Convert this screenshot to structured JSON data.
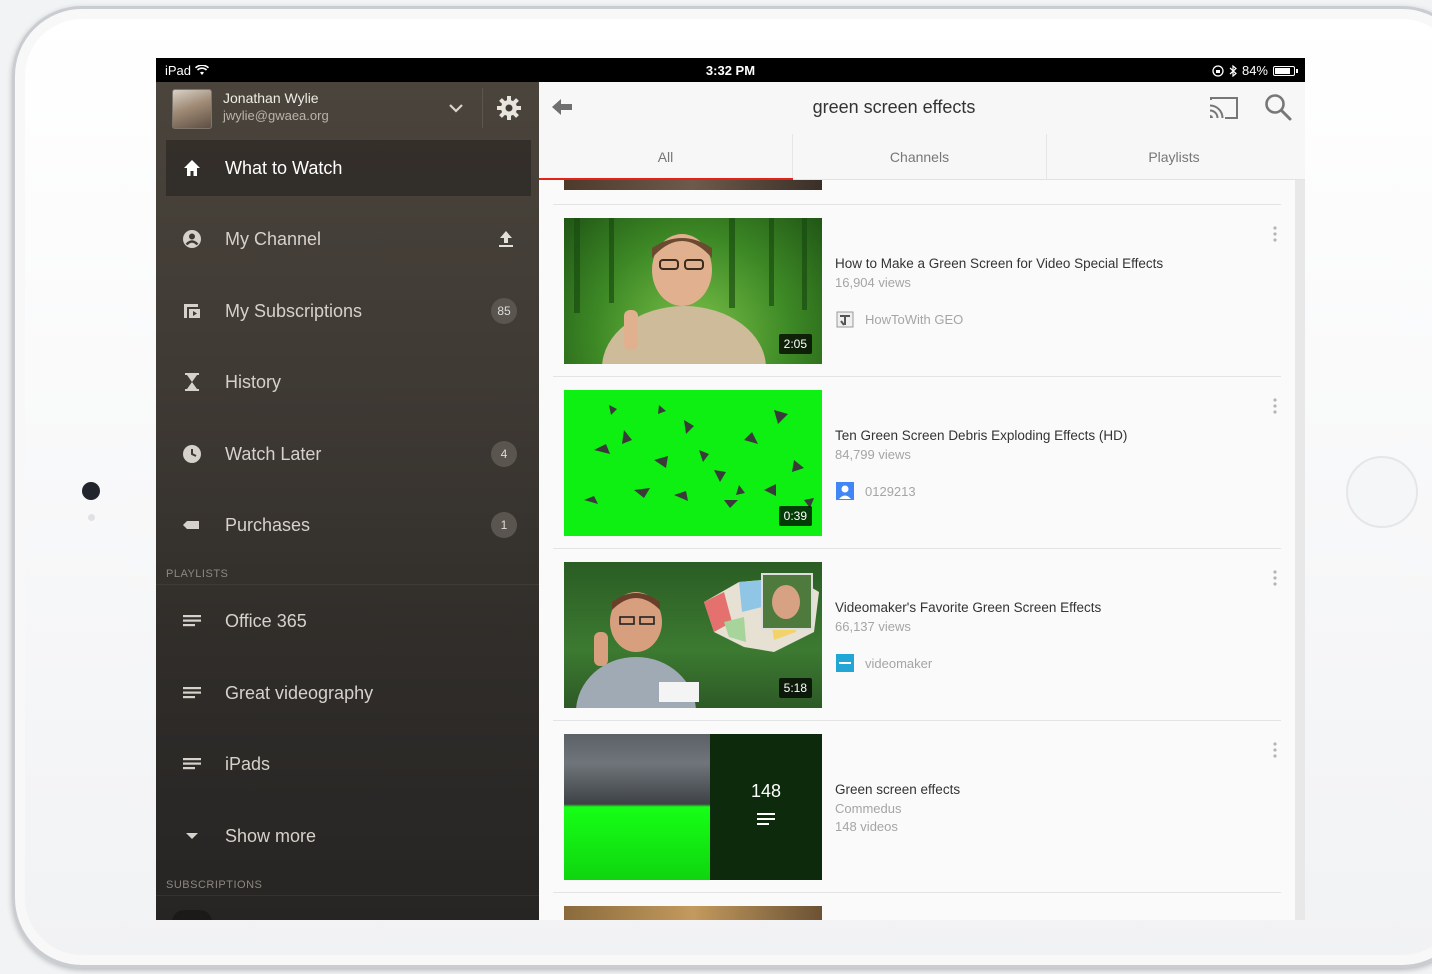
{
  "status_bar": {
    "device": "iPad",
    "time": "3:32 PM",
    "battery": "84%",
    "battery_level": 0.84
  },
  "account": {
    "name": "Jonathan Wylie",
    "email": "jwylie@gwaea.org"
  },
  "sidebar": {
    "items": [
      {
        "label": "What to Watch",
        "icon": "home-icon",
        "active": true
      },
      {
        "label": "My Channel",
        "icon": "account-circle-icon",
        "action": "upload-icon"
      },
      {
        "label": "My Subscriptions",
        "icon": "subscriptions-icon",
        "badge": "85"
      },
      {
        "label": "History",
        "icon": "hourglass-icon"
      },
      {
        "label": "Watch Later",
        "icon": "clock-icon",
        "badge": "4"
      },
      {
        "label": "Purchases",
        "icon": "tag-icon",
        "badge": "1"
      }
    ],
    "playlists_title": "PLAYLISTS",
    "playlists": [
      {
        "label": "Office 365",
        "icon": "playlist-icon"
      },
      {
        "label": "Great videography",
        "icon": "playlist-icon"
      },
      {
        "label": "iPads",
        "icon": "playlist-icon"
      }
    ],
    "show_more": "Show more",
    "subscriptions_title": "SUBSCRIPTIONS"
  },
  "topbar": {
    "query": "green screen effects"
  },
  "tabs": [
    {
      "label": "All",
      "selected": true
    },
    {
      "label": "Channels",
      "selected": false
    },
    {
      "label": "Playlists",
      "selected": false
    }
  ],
  "results": [
    {
      "title": "How to Make a Green Screen for Video Special Effects",
      "views": "16,904 views",
      "channel": "HowToWith GEO",
      "duration": "2:05"
    },
    {
      "title": "Ten Green Screen Debris Exploding Effects  (HD)",
      "views": "84,799 views",
      "channel": "0129213",
      "duration": "0:39"
    },
    {
      "title": "Videomaker's Favorite Green Screen Effects",
      "views": "66,137 views",
      "channel": "videomaker",
      "duration": "5:18"
    },
    {
      "title": "Green screen effects",
      "owner": "Commedus",
      "video_count": "148 videos",
      "thumb_count": "148"
    }
  ],
  "colors": {
    "accent": "#e62117",
    "sidebar_bg": "#3f3a34",
    "main_bg": "#fafafa"
  }
}
